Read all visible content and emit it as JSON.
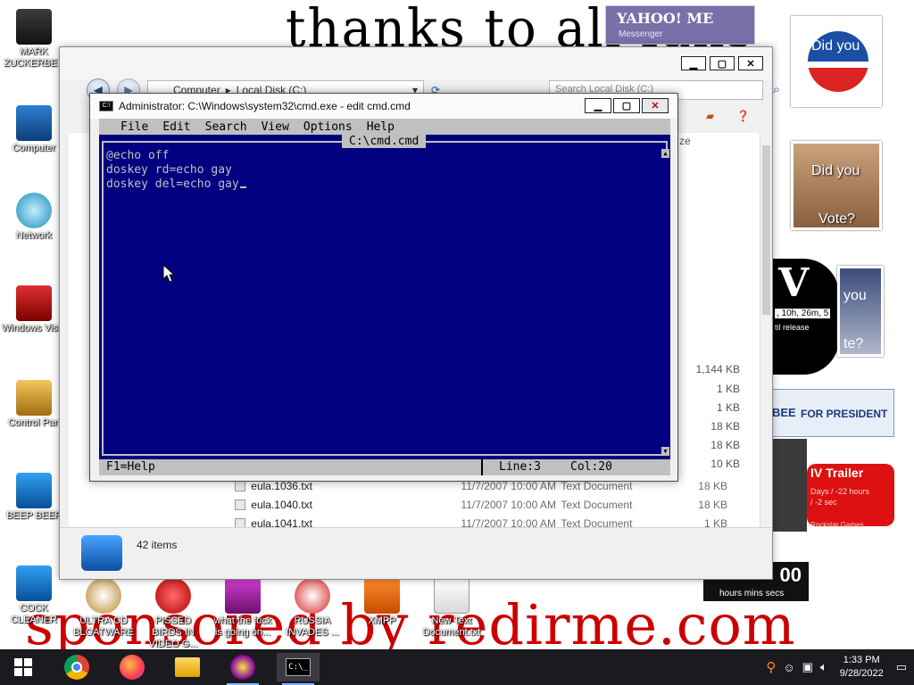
{
  "wallpaper": {
    "top_text": "thanks to all fans",
    "bottom_text": "sponsored by redirme.com",
    "countdown": "00",
    "countdown_label": "hours mins secs",
    "poster_vote_1": "Did you",
    "poster_vote_2": "Did you",
    "poster_vote_3": "Vote?",
    "poster_vote_4": "you",
    "poster_vote_5": "te?",
    "president_text": "FOR PRESIDENT",
    "president_prefix": "BEE",
    "gta_trailer": "IV Trailer",
    "gta_days": "Days / -22 hours",
    "gta_secs": "/ -2 sec",
    "gta_rockstar": "Rockstar Games",
    "timer_text": ", 10h, 26m, 5",
    "timer_release": "til release",
    "yahoo": "YAHOO! ME",
    "yahoo_sub": "Messenger"
  },
  "desktop_icons": [
    {
      "label": "MARK ZUCKERBER"
    },
    {
      "label": "Computer"
    },
    {
      "label": "Network"
    },
    {
      "label": "Windows Vista"
    },
    {
      "label": "Control Pan"
    },
    {
      "label": "BEEP BEEP"
    },
    {
      "label": "COCK CLEANER"
    },
    {
      "label": "ULTRA CD BLOATWARE"
    },
    {
      "label": "PISSED BIRDS IN VIDEO G..."
    },
    {
      "label": "what the fuck is going on..."
    },
    {
      "label": "RUSSIA INVADES ..."
    },
    {
      "label": "XMPP"
    },
    {
      "label": "New Text Document.txt"
    }
  ],
  "explorer": {
    "breadcrumb": [
      "Computer",
      "Local Disk (C:)"
    ],
    "search_placeholder": "Search Local Disk (C:)",
    "size_header": "ze",
    "sizes": [
      "1,144 KB",
      "1 KB",
      "1 KB",
      "18 KB",
      "18 KB",
      "10 KB"
    ],
    "files": [
      {
        "name": "eula.1036.txt",
        "date": "11/7/2007 10:00 AM",
        "type": "Text Document",
        "size": "18 KB"
      },
      {
        "name": "eula.1040.txt",
        "date": "11/7/2007 10:00 AM",
        "type": "Text Document",
        "size": "18 KB"
      },
      {
        "name": "eula.1041.txt",
        "date": "11/7/2007 10:00 AM",
        "type": "Text Document",
        "size": "1 KB"
      }
    ],
    "status": "42 items"
  },
  "cmd": {
    "title": "Administrator: C:\\Windows\\system32\\cmd.exe - edit  cmd.cmd",
    "menu": [
      "File",
      "Edit",
      "Search",
      "View",
      "Options",
      "Help"
    ],
    "doc_title": "C:\\cmd.cmd",
    "lines": [
      "@echo off",
      "doskey rd=echo gay",
      "doskey del=echo gay"
    ],
    "status_help": "F1=Help",
    "status_line": "Line:3",
    "status_col": "Col:20"
  },
  "taskbar": {
    "time": "1:33 PM",
    "date": "9/28/2022"
  },
  "colors": {
    "edit_bg": "#000080",
    "edit_fg": "#c0c0c0",
    "chrome": "#c0c0c0",
    "taskbar": "#1b1b1f",
    "wall_red": "#cc0000"
  }
}
